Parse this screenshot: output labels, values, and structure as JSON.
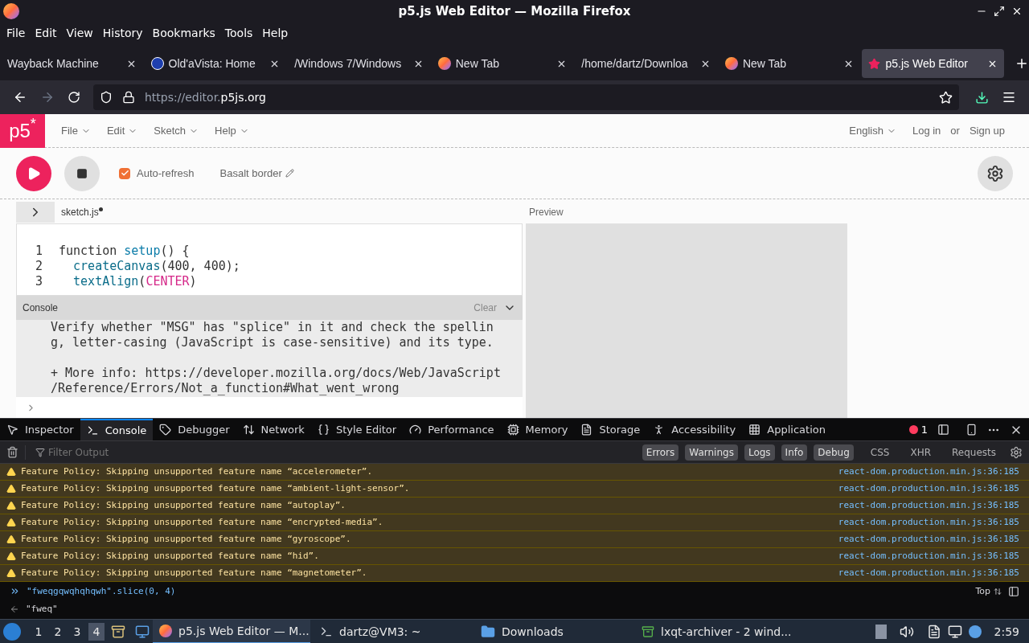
{
  "window": {
    "title": "p5.js Web Editor — Mozilla Firefox"
  },
  "menu": [
    "File",
    "Edit",
    "View",
    "History",
    "Bookmarks",
    "Tools",
    "Help"
  ],
  "tabs": [
    {
      "label": "Wayback Machine",
      "kind": "none",
      "selected": false
    },
    {
      "label": "Old'aVista: Home",
      "kind": "badge",
      "selected": false
    },
    {
      "label": "/Windows 7/Windows",
      "kind": "none",
      "selected": false
    },
    {
      "label": "New Tab",
      "kind": "firefox",
      "selected": false
    },
    {
      "label": "/home/dartz/Downloa",
      "kind": "none",
      "selected": false
    },
    {
      "label": "New Tab",
      "kind": "firefox",
      "selected": false
    },
    {
      "label": "p5.js Web Editor",
      "kind": "star",
      "selected": true
    }
  ],
  "url": {
    "prefix": "https://editor.",
    "domain": "p5js.org"
  },
  "p5": {
    "logo": "p5$^{*}$",
    "menus": [
      "File",
      "Edit",
      "Sketch",
      "Help"
    ],
    "language": "English",
    "login": "Log in",
    "or": "or",
    "signup": "Sign up",
    "auto_refresh": {
      "label": "Auto-refresh",
      "checked": true
    },
    "sketch_name": "Basalt border",
    "file": {
      "name": "sketch.js",
      "unsaved": true
    },
    "code": [
      {
        "number": "1",
        "tokens": [
          {
            "text": "function ",
            "kind": "plain"
          },
          {
            "text": "setup",
            "kind": "def"
          },
          {
            "text": "() {",
            "kind": "plain"
          }
        ]
      },
      {
        "number": "2",
        "tokens": [
          {
            "text": "  createCanvas",
            "kind": "call"
          },
          {
            "text": "(400, 400);",
            "kind": "plain"
          }
        ]
      },
      {
        "number": "3",
        "tokens": [
          {
            "text": "  textAlign",
            "kind": "call"
          },
          {
            "text": "(",
            "kind": "plain"
          },
          {
            "text": "CENTER",
            "kind": "const"
          },
          {
            "text": ")",
            "kind": "plain"
          }
        ]
      }
    ],
    "console": {
      "title": "Console",
      "clear": "Clear",
      "paragraphs": [
        [
          "Verify whether \"MSG\" has \"splice\" in it and check the spellin",
          "g, letter-casing (JavaScript is case-sensitive) and its type."
        ],
        [
          "+ More info: https://developer.mozilla.org/docs/Web/JavaScript",
          "/Reference/Errors/Not_a_function#What_went_wrong"
        ]
      ]
    },
    "preview": "Preview"
  },
  "devtools": {
    "tabs": [
      {
        "label": "Inspector",
        "selected": false
      },
      {
        "label": "Console",
        "selected": true
      },
      {
        "label": "Debugger",
        "selected": false
      },
      {
        "label": "Network",
        "selected": false
      },
      {
        "label": "Style Editor",
        "selected": false
      },
      {
        "label": "Performance",
        "selected": false
      },
      {
        "label": "Memory",
        "selected": false
      },
      {
        "label": "Storage",
        "selected": false
      },
      {
        "label": "Accessibility",
        "selected": false
      },
      {
        "label": "Application",
        "selected": false
      }
    ],
    "error_count": "1",
    "filter_placeholder": "Filter Output",
    "filters": [
      {
        "label": "Errors",
        "on": true
      },
      {
        "label": "Warnings",
        "on": true
      },
      {
        "label": "Logs",
        "on": true
      },
      {
        "label": "Info",
        "on": true
      },
      {
        "label": "Debug",
        "on": true
      },
      {
        "label": "CSS",
        "on": false
      },
      {
        "label": "XHR",
        "on": false
      },
      {
        "label": "Requests",
        "on": false
      }
    ],
    "messages": [
      {
        "text": "Feature Policy: Skipping unsupported feature name “accelerometer”.",
        "source": "react-dom.production.min.js:36:185"
      },
      {
        "text": "Feature Policy: Skipping unsupported feature name “ambient-light-sensor”.",
        "source": "react-dom.production.min.js:36:185"
      },
      {
        "text": "Feature Policy: Skipping unsupported feature name “autoplay”.",
        "source": "react-dom.production.min.js:36:185"
      },
      {
        "text": "Feature Policy: Skipping unsupported feature name “encrypted-media”.",
        "source": "react-dom.production.min.js:36:185"
      },
      {
        "text": "Feature Policy: Skipping unsupported feature name “gyroscope”.",
        "source": "react-dom.production.min.js:36:185"
      },
      {
        "text": "Feature Policy: Skipping unsupported feature name “hid”.",
        "source": "react-dom.production.min.js:36:185"
      },
      {
        "text": "Feature Policy: Skipping unsupported feature name “magnetometer”.",
        "source": "react-dom.production.min.js:36:185"
      }
    ],
    "input": "\"fweqgqwqhqhqwh\".slice(0, 4)",
    "result": "\"fweq\"",
    "context": "Top"
  },
  "taskbar": {
    "workspaces": [
      {
        "label": "1",
        "selected": false
      },
      {
        "label": "2",
        "selected": false
      },
      {
        "label": "3",
        "selected": false
      },
      {
        "label": "4",
        "selected": true
      }
    ],
    "tasks": [
      {
        "label": "p5.js Web Editor — M...",
        "kind": "firefox",
        "selected": true
      },
      {
        "label": "dartz@VM3: ~",
        "kind": "terminal",
        "selected": false
      },
      {
        "label": "Downloads",
        "kind": "folder",
        "selected": false
      },
      {
        "label": "lxqt-archiver - 2 wind...",
        "kind": "archive",
        "selected": false
      }
    ],
    "clock": "2:59"
  }
}
